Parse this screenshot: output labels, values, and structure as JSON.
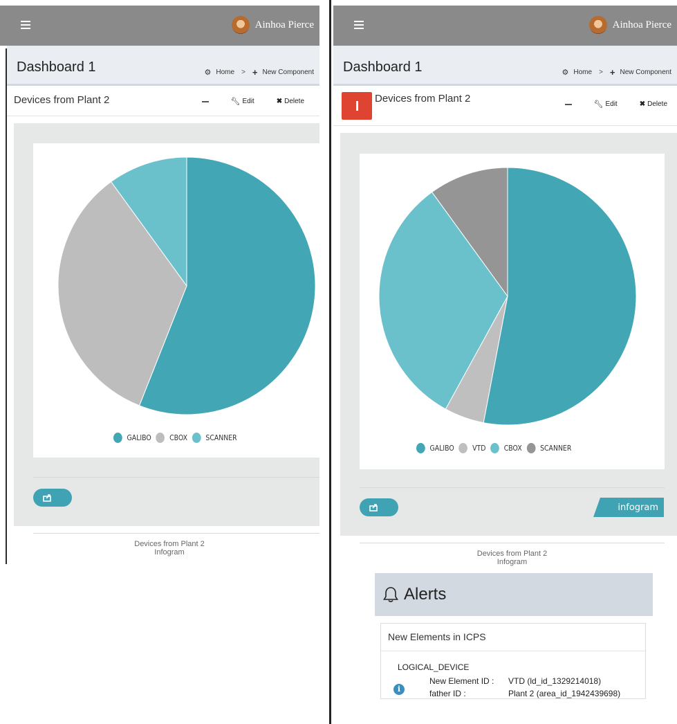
{
  "user": {
    "name": "Ainhoa Pierce"
  },
  "dashboard": {
    "title": "Dashboard 1"
  },
  "breadcrumb": {
    "home": "Home",
    "separator": ">",
    "new_component": "New Component"
  },
  "widget": {
    "title": "Devices from Plant 2",
    "edit_label": "Edit",
    "delete_label": "Delete",
    "caption_line1": "Devices from Plant 2",
    "caption_line2": "Infogram",
    "brand_tag": "infogram"
  },
  "colors": {
    "galibo": "#42a6b5",
    "vtd": "#bfbfbf",
    "cbox_left": "#bdbdbd",
    "cbox_right": "#6ac1cb",
    "scanner_left": "#6ac1cb",
    "scanner_right": "#959595",
    "topbar": "#8a8a8a",
    "alert_red": "#df4433"
  },
  "chart_data": [
    {
      "type": "pie",
      "series": [
        {
          "categories": [
            "GALIBO",
            "CBOX",
            "SCANNER"
          ],
          "values": [
            56,
            34,
            10
          ]
        }
      ],
      "legend": [
        "GALIBO",
        "CBOX",
        "SCANNER"
      ],
      "legend_position": "bottom"
    },
    {
      "type": "pie",
      "series": [
        {
          "categories": [
            "GALIBO",
            "VTD",
            "CBOX",
            "SCANNER"
          ],
          "values": [
            53,
            5,
            32,
            10
          ]
        }
      ],
      "legend": [
        "GALIBO",
        "VTD",
        "CBOX",
        "SCANNER"
      ],
      "legend_position": "bottom"
    }
  ],
  "alerts": {
    "title": "Alerts",
    "box_title": "New Elements in ICPS",
    "type": "LOGICAL_DEVICE",
    "rows": [
      {
        "label": "New Element ID :",
        "value": "VTD (ld_id_1329214018)"
      },
      {
        "label": "father ID :",
        "value": "Plant 2 (area_id_1942439698)"
      }
    ]
  }
}
